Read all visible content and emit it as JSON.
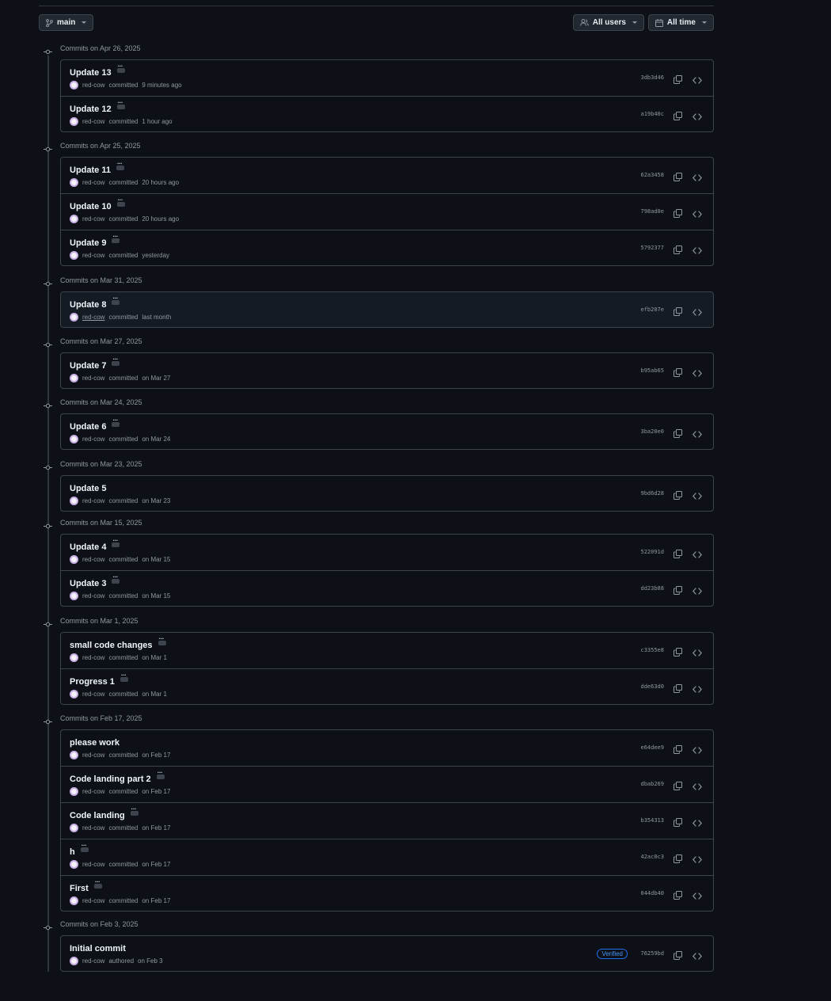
{
  "toolbar": {
    "branch_label": "main",
    "users_label": "All users",
    "time_label": "All time"
  },
  "groups": [
    {
      "title": "Commits on Apr 26, 2025",
      "commits": [
        {
          "message": "Update 13",
          "author": "red-cow",
          "action": "committed",
          "time": "9 minutes ago",
          "sha": "3db3d46"
        },
        {
          "message": "Update 12",
          "author": "red-cow",
          "action": "committed",
          "time": "1 hour ago",
          "sha": "a19b40c"
        }
      ]
    },
    {
      "title": "Commits on Apr 25, 2025",
      "commits": [
        {
          "message": "Update 11",
          "author": "red-cow",
          "action": "committed",
          "time": "20 hours ago",
          "sha": "62a3458"
        },
        {
          "message": "Update 10",
          "author": "red-cow",
          "action": "committed",
          "time": "20 hours ago",
          "sha": "798ad0e"
        },
        {
          "message": "Update 9",
          "author": "red-cow",
          "action": "committed",
          "time": "yesterday",
          "sha": "5792377"
        }
      ]
    },
    {
      "title": "Commits on Mar 31, 2025",
      "commits": [
        {
          "message": "Update 8",
          "author": "red-cow",
          "action": "committed",
          "time": "last month",
          "sha": "efb207e"
        }
      ]
    },
    {
      "title": "Commits on Mar 27, 2025",
      "commits": [
        {
          "message": "Update 7",
          "author": "red-cow",
          "action": "committed",
          "time": "on Mar 27",
          "sha": "b95ab65"
        }
      ]
    },
    {
      "title": "Commits on Mar 24, 2025",
      "commits": [
        {
          "message": "Update 6",
          "author": "red-cow",
          "action": "committed",
          "time": "on Mar 24",
          "sha": "3ba20e0"
        }
      ]
    },
    {
      "title": "Commits on Mar 23, 2025",
      "commits": [
        {
          "message": "Update 5",
          "author": "red-cow",
          "action": "committed",
          "time": "on Mar 23",
          "sha": "9bd6d28"
        }
      ]
    },
    {
      "title": "Commits on Mar 15, 2025",
      "commits": [
        {
          "message": "Update 4",
          "author": "red-cow",
          "action": "committed",
          "time": "on Mar 15",
          "sha": "522091d"
        },
        {
          "message": "Update 3",
          "author": "red-cow",
          "action": "committed",
          "time": "on Mar 15",
          "sha": "dd23b88"
        }
      ]
    },
    {
      "title": "Commits on Mar 1, 2025",
      "commits": [
        {
          "message": "small code changes",
          "author": "red-cow",
          "action": "committed",
          "time": "on Mar 1",
          "sha": "c3355e8"
        },
        {
          "message": "Progress 1",
          "author": "red-cow",
          "action": "committed",
          "time": "on Mar 1",
          "sha": "dde63d0"
        }
      ]
    },
    {
      "title": "Commits on Feb 17, 2025",
      "commits": [
        {
          "message": "please work",
          "author": "red-cow",
          "action": "committed",
          "time": "on Feb 17",
          "sha": "e64dee9"
        },
        {
          "message": "Code landing part 2",
          "author": "red-cow",
          "action": "committed",
          "time": "on Feb 17",
          "sha": "dbab269"
        },
        {
          "message": "Code landing",
          "author": "red-cow",
          "action": "committed",
          "time": "on Feb 17",
          "sha": "b354313"
        },
        {
          "message": "h",
          "author": "red-cow",
          "action": "committed",
          "time": "on Feb 17",
          "sha": "42ac0c3"
        },
        {
          "message": "First",
          "author": "red-cow",
          "action": "committed",
          "time": "on Feb 17",
          "sha": "044db40"
        }
      ]
    },
    {
      "title": "Commits on Feb 3, 2025",
      "commits": [
        {
          "message": "Initial commit",
          "author": "red-cow",
          "action": "authored",
          "time": "on Feb 3",
          "sha": "76259bd",
          "verified": "Verified"
        }
      ]
    }
  ]
}
